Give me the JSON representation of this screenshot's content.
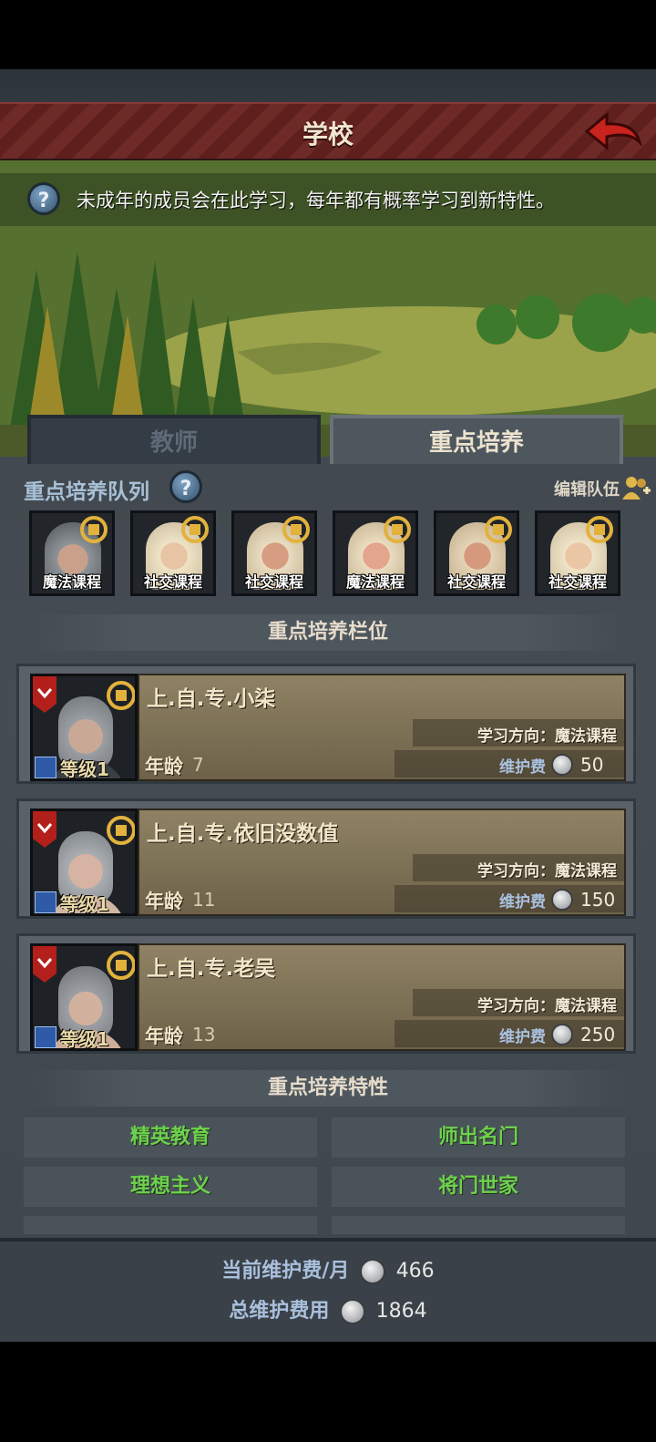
{
  "header": {
    "title": "学校"
  },
  "tip": {
    "text": "未成年的成员会在此学习，每年都有概率学习到新特性。"
  },
  "tabs": [
    {
      "label": "教师"
    },
    {
      "label": "重点培养"
    }
  ],
  "queue": {
    "label": "重点培养队列",
    "edit_label": "编辑队伍",
    "slots": [
      {
        "course": "魔法课程"
      },
      {
        "course": "社交课程"
      },
      {
        "course": "社交课程"
      },
      {
        "course": "魔法课程"
      },
      {
        "course": "社交课程"
      },
      {
        "course": "社交课程"
      }
    ]
  },
  "slots_section": {
    "title": "重点培养栏位"
  },
  "students": [
    {
      "name": "上.自.专.小柒",
      "level_label": "等级1",
      "age_label": "年龄",
      "age": "7",
      "direction": "学习方向：魔法课程",
      "fee_label": "维护费",
      "fee": "50"
    },
    {
      "name": "上.自.专.依旧没数值",
      "level_label": "等级1",
      "age_label": "年龄",
      "age": "11",
      "direction": "学习方向：魔法课程",
      "fee_label": "维护费",
      "fee": "150"
    },
    {
      "name": "上.自.专.老吴",
      "level_label": "等级1",
      "age_label": "年龄",
      "age": "13",
      "direction": "学习方向：魔法课程",
      "fee_label": "维护费",
      "fee": "250"
    }
  ],
  "traits_section": {
    "title": "重点培养特性"
  },
  "traits": [
    {
      "label": "精英教育"
    },
    {
      "label": "师出名门"
    },
    {
      "label": "理想主义"
    },
    {
      "label": "将门世家"
    }
  ],
  "footer": {
    "current_label": "当前维护费/月",
    "current_value": "466",
    "total_label": "总维护费用",
    "total_value": "1864"
  },
  "colors": {
    "header": "#6d2a27",
    "trait_text": "#6dd14e",
    "fee_label": "#a9c1e0"
  },
  "icons": {
    "help": "question-icon",
    "back": "back-arrow-icon",
    "swap": "swap-course-icon",
    "edit": "edit-team-icon",
    "coin": "silver-coin-icon"
  }
}
